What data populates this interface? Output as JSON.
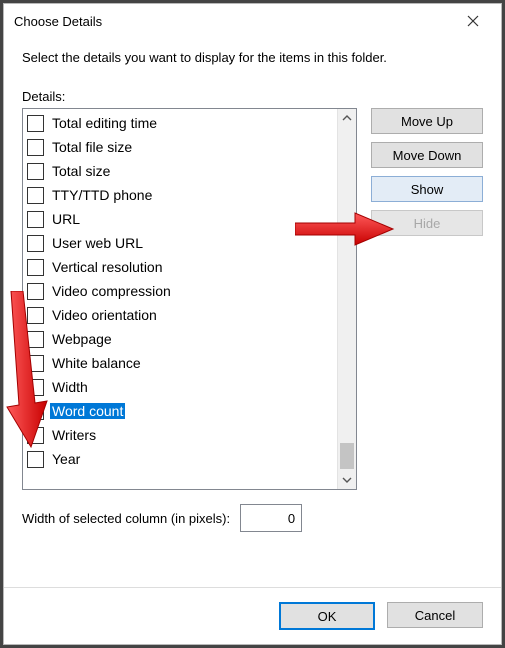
{
  "window": {
    "title": "Choose Details",
    "instruction": "Select the details you want to display for the items in this folder.",
    "details_label": "Details:"
  },
  "details": [
    {
      "label": "Total editing time",
      "checked": false,
      "selected": false
    },
    {
      "label": "Total file size",
      "checked": false,
      "selected": false
    },
    {
      "label": "Total size",
      "checked": false,
      "selected": false
    },
    {
      "label": "TTY/TTD phone",
      "checked": false,
      "selected": false
    },
    {
      "label": "URL",
      "checked": false,
      "selected": false
    },
    {
      "label": "User web URL",
      "checked": false,
      "selected": false
    },
    {
      "label": "Vertical resolution",
      "checked": false,
      "selected": false
    },
    {
      "label": "Video compression",
      "checked": false,
      "selected": false
    },
    {
      "label": "Video orientation",
      "checked": false,
      "selected": false
    },
    {
      "label": "Webpage",
      "checked": false,
      "selected": false
    },
    {
      "label": "White balance",
      "checked": false,
      "selected": false
    },
    {
      "label": "Width",
      "checked": false,
      "selected": false
    },
    {
      "label": "Word count",
      "checked": false,
      "selected": true
    },
    {
      "label": "Writers",
      "checked": false,
      "selected": false
    },
    {
      "label": "Year",
      "checked": false,
      "selected": false
    }
  ],
  "buttons": {
    "move_up": "Move Up",
    "move_down": "Move Down",
    "show": "Show",
    "hide": "Hide"
  },
  "width_field": {
    "label": "Width of selected column (in pixels):",
    "value": "0"
  },
  "footer": {
    "ok": "OK",
    "cancel": "Cancel"
  }
}
